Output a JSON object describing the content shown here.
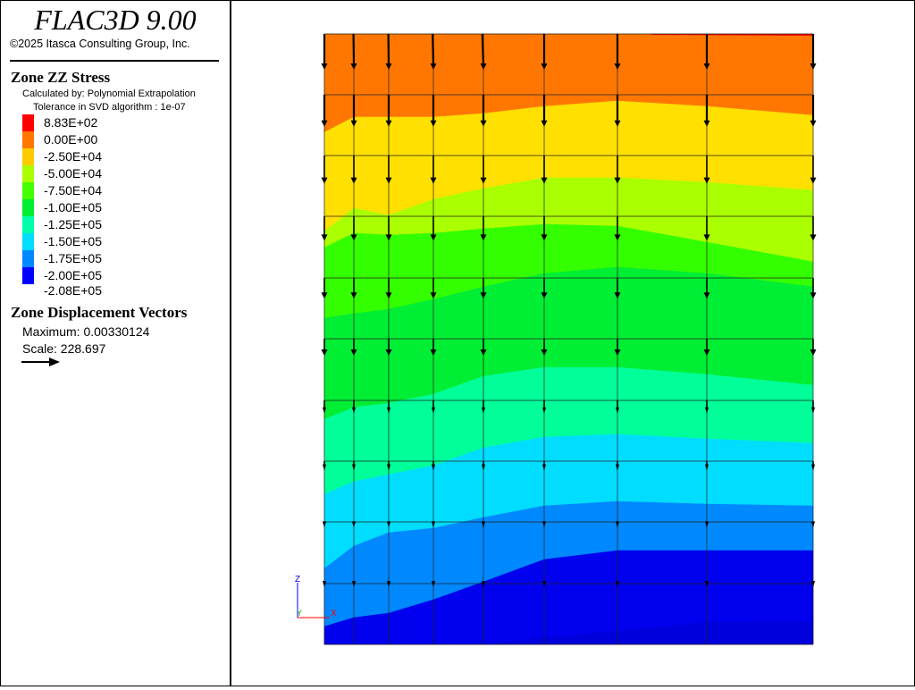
{
  "app": {
    "title": "FLAC3D 9.00",
    "copyright": "©2025 Itasca Consulting Group, Inc."
  },
  "legend": {
    "zz_stress": {
      "heading": "Zone ZZ Stress",
      "calc_line": "Calculated by: Polynomial Extrapolation",
      "tol_line": "Tolerance in SVD algorithm : 1e-07",
      "items": [
        {
          "color": "#ff0000",
          "label": "8.83E+02"
        },
        {
          "color": "#ff7700",
          "label": "0.00E+00"
        },
        {
          "color": "#ffcc00",
          "label": "-2.50E+04"
        },
        {
          "color": "#aaff00",
          "label": "-5.00E+04"
        },
        {
          "color": "#44ff00",
          "label": "-7.50E+04"
        },
        {
          "color": "#00ee33",
          "label": "-1.00E+05"
        },
        {
          "color": "#00ffaa",
          "label": "-1.25E+05"
        },
        {
          "color": "#00ddff",
          "label": "-1.50E+05"
        },
        {
          "color": "#0088ff",
          "label": "-1.75E+05"
        },
        {
          "color": "#0000ff",
          "label": "-2.00E+05"
        },
        {
          "color": "",
          "label": "-2.08E+05"
        }
      ]
    },
    "displacement": {
      "heading": "Zone Displacement Vectors",
      "maximum": "Maximum: 0.00330124",
      "scale": "Scale: 228.697"
    }
  },
  "axes": {
    "z": "Z",
    "y": "Y",
    "x": "X",
    "z_color": "#0000ff",
    "y_color": "#00aa00",
    "x_color": "#ff0000"
  },
  "contours": {
    "band_colors": [
      "#ff7700",
      "#ffe000",
      "#aaff00",
      "#33ff00",
      "#00ee33",
      "#00ff99",
      "#00ddff",
      "#0088ff",
      "#0000ee"
    ]
  }
}
